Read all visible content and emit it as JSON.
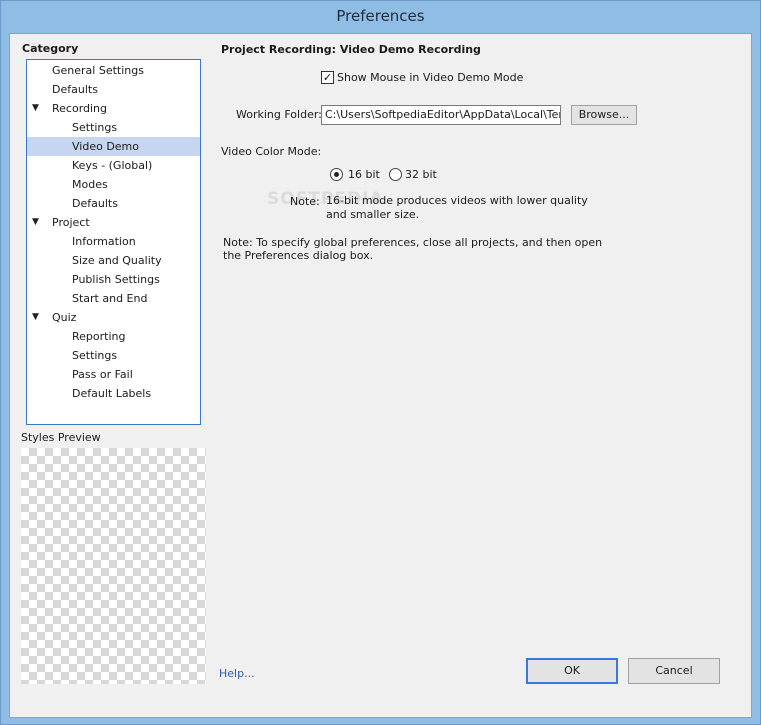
{
  "window": {
    "title": "Preferences"
  },
  "category": {
    "heading": "Category",
    "tree": [
      {
        "label": "General Settings",
        "level": 0,
        "arrow": ""
      },
      {
        "label": "Defaults",
        "level": 0,
        "arrow": ""
      },
      {
        "label": "Recording",
        "level": 0,
        "arrow": "▼"
      },
      {
        "label": "Settings",
        "level": 1,
        "arrow": ""
      },
      {
        "label": "Video Demo",
        "level": 1,
        "arrow": "",
        "selected": true
      },
      {
        "label": "Keys - (Global)",
        "level": 1,
        "arrow": ""
      },
      {
        "label": "Modes",
        "level": 1,
        "arrow": ""
      },
      {
        "label": "Defaults",
        "level": 1,
        "arrow": ""
      },
      {
        "label": "Project",
        "level": 0,
        "arrow": "▼"
      },
      {
        "label": "Information",
        "level": 1,
        "arrow": ""
      },
      {
        "label": "Size and Quality",
        "level": 1,
        "arrow": ""
      },
      {
        "label": "Publish Settings",
        "level": 1,
        "arrow": ""
      },
      {
        "label": "Start and End",
        "level": 1,
        "arrow": ""
      },
      {
        "label": "Quiz",
        "level": 0,
        "arrow": "▼"
      },
      {
        "label": "Reporting",
        "level": 1,
        "arrow": ""
      },
      {
        "label": "Settings",
        "level": 1,
        "arrow": ""
      },
      {
        "label": "Pass or Fail",
        "level": 1,
        "arrow": ""
      },
      {
        "label": "Default Labels",
        "level": 1,
        "arrow": ""
      }
    ],
    "styles_preview": "Styles Preview"
  },
  "panel": {
    "title": "Project Recording: Video Demo Recording",
    "show_mouse": {
      "label": "Show Mouse in Video Demo Mode",
      "checked": true
    },
    "working_folder": {
      "label": "Working Folder:",
      "value": "C:\\Users\\SoftpediaEditor\\AppData\\Local\\Temp\\C",
      "browse": "Browse..."
    },
    "color_mode": {
      "label": "Video Color Mode:",
      "opt16": "16 bit",
      "opt32": "32 bit",
      "selected": "16 bit"
    },
    "note_label": "Note:",
    "note_line1": "16-bit mode produces videos with lower quality",
    "note_line2": "and smaller size.",
    "global_note_line1": "Note: To specify global preferences, close all projects, and then open",
    "global_note_line2": "the Preferences dialog box."
  },
  "footer": {
    "help": "Help...",
    "ok": "OK",
    "cancel": "Cancel"
  },
  "watermark": "SOFTPEDIA"
}
